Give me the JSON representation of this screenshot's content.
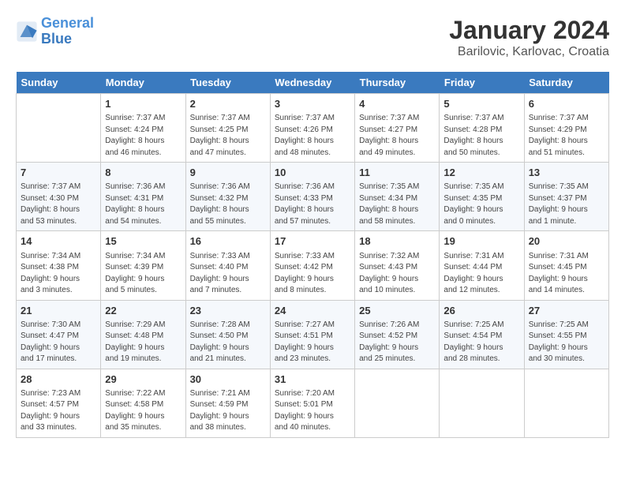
{
  "header": {
    "logo_line1": "General",
    "logo_line2": "Blue",
    "title": "January 2024",
    "subtitle": "Barilovic, Karlovac, Croatia"
  },
  "days_of_week": [
    "Sunday",
    "Monday",
    "Tuesday",
    "Wednesday",
    "Thursday",
    "Friday",
    "Saturday"
  ],
  "weeks": [
    [
      {
        "day": "",
        "info": ""
      },
      {
        "day": "1",
        "info": "Sunrise: 7:37 AM\nSunset: 4:24 PM\nDaylight: 8 hours\nand 46 minutes."
      },
      {
        "day": "2",
        "info": "Sunrise: 7:37 AM\nSunset: 4:25 PM\nDaylight: 8 hours\nand 47 minutes."
      },
      {
        "day": "3",
        "info": "Sunrise: 7:37 AM\nSunset: 4:26 PM\nDaylight: 8 hours\nand 48 minutes."
      },
      {
        "day": "4",
        "info": "Sunrise: 7:37 AM\nSunset: 4:27 PM\nDaylight: 8 hours\nand 49 minutes."
      },
      {
        "day": "5",
        "info": "Sunrise: 7:37 AM\nSunset: 4:28 PM\nDaylight: 8 hours\nand 50 minutes."
      },
      {
        "day": "6",
        "info": "Sunrise: 7:37 AM\nSunset: 4:29 PM\nDaylight: 8 hours\nand 51 minutes."
      }
    ],
    [
      {
        "day": "7",
        "info": "Sunrise: 7:37 AM\nSunset: 4:30 PM\nDaylight: 8 hours\nand 53 minutes."
      },
      {
        "day": "8",
        "info": "Sunrise: 7:36 AM\nSunset: 4:31 PM\nDaylight: 8 hours\nand 54 minutes."
      },
      {
        "day": "9",
        "info": "Sunrise: 7:36 AM\nSunset: 4:32 PM\nDaylight: 8 hours\nand 55 minutes."
      },
      {
        "day": "10",
        "info": "Sunrise: 7:36 AM\nSunset: 4:33 PM\nDaylight: 8 hours\nand 57 minutes."
      },
      {
        "day": "11",
        "info": "Sunrise: 7:35 AM\nSunset: 4:34 PM\nDaylight: 8 hours\nand 58 minutes."
      },
      {
        "day": "12",
        "info": "Sunrise: 7:35 AM\nSunset: 4:35 PM\nDaylight: 9 hours\nand 0 minutes."
      },
      {
        "day": "13",
        "info": "Sunrise: 7:35 AM\nSunset: 4:37 PM\nDaylight: 9 hours\nand 1 minute."
      }
    ],
    [
      {
        "day": "14",
        "info": "Sunrise: 7:34 AM\nSunset: 4:38 PM\nDaylight: 9 hours\nand 3 minutes."
      },
      {
        "day": "15",
        "info": "Sunrise: 7:34 AM\nSunset: 4:39 PM\nDaylight: 9 hours\nand 5 minutes."
      },
      {
        "day": "16",
        "info": "Sunrise: 7:33 AM\nSunset: 4:40 PM\nDaylight: 9 hours\nand 7 minutes."
      },
      {
        "day": "17",
        "info": "Sunrise: 7:33 AM\nSunset: 4:42 PM\nDaylight: 9 hours\nand 8 minutes."
      },
      {
        "day": "18",
        "info": "Sunrise: 7:32 AM\nSunset: 4:43 PM\nDaylight: 9 hours\nand 10 minutes."
      },
      {
        "day": "19",
        "info": "Sunrise: 7:31 AM\nSunset: 4:44 PM\nDaylight: 9 hours\nand 12 minutes."
      },
      {
        "day": "20",
        "info": "Sunrise: 7:31 AM\nSunset: 4:45 PM\nDaylight: 9 hours\nand 14 minutes."
      }
    ],
    [
      {
        "day": "21",
        "info": "Sunrise: 7:30 AM\nSunset: 4:47 PM\nDaylight: 9 hours\nand 17 minutes."
      },
      {
        "day": "22",
        "info": "Sunrise: 7:29 AM\nSunset: 4:48 PM\nDaylight: 9 hours\nand 19 minutes."
      },
      {
        "day": "23",
        "info": "Sunrise: 7:28 AM\nSunset: 4:50 PM\nDaylight: 9 hours\nand 21 minutes."
      },
      {
        "day": "24",
        "info": "Sunrise: 7:27 AM\nSunset: 4:51 PM\nDaylight: 9 hours\nand 23 minutes."
      },
      {
        "day": "25",
        "info": "Sunrise: 7:26 AM\nSunset: 4:52 PM\nDaylight: 9 hours\nand 25 minutes."
      },
      {
        "day": "26",
        "info": "Sunrise: 7:25 AM\nSunset: 4:54 PM\nDaylight: 9 hours\nand 28 minutes."
      },
      {
        "day": "27",
        "info": "Sunrise: 7:25 AM\nSunset: 4:55 PM\nDaylight: 9 hours\nand 30 minutes."
      }
    ],
    [
      {
        "day": "28",
        "info": "Sunrise: 7:23 AM\nSunset: 4:57 PM\nDaylight: 9 hours\nand 33 minutes."
      },
      {
        "day": "29",
        "info": "Sunrise: 7:22 AM\nSunset: 4:58 PM\nDaylight: 9 hours\nand 35 minutes."
      },
      {
        "day": "30",
        "info": "Sunrise: 7:21 AM\nSunset: 4:59 PM\nDaylight: 9 hours\nand 38 minutes."
      },
      {
        "day": "31",
        "info": "Sunrise: 7:20 AM\nSunset: 5:01 PM\nDaylight: 9 hours\nand 40 minutes."
      },
      {
        "day": "",
        "info": ""
      },
      {
        "day": "",
        "info": ""
      },
      {
        "day": "",
        "info": ""
      }
    ]
  ]
}
